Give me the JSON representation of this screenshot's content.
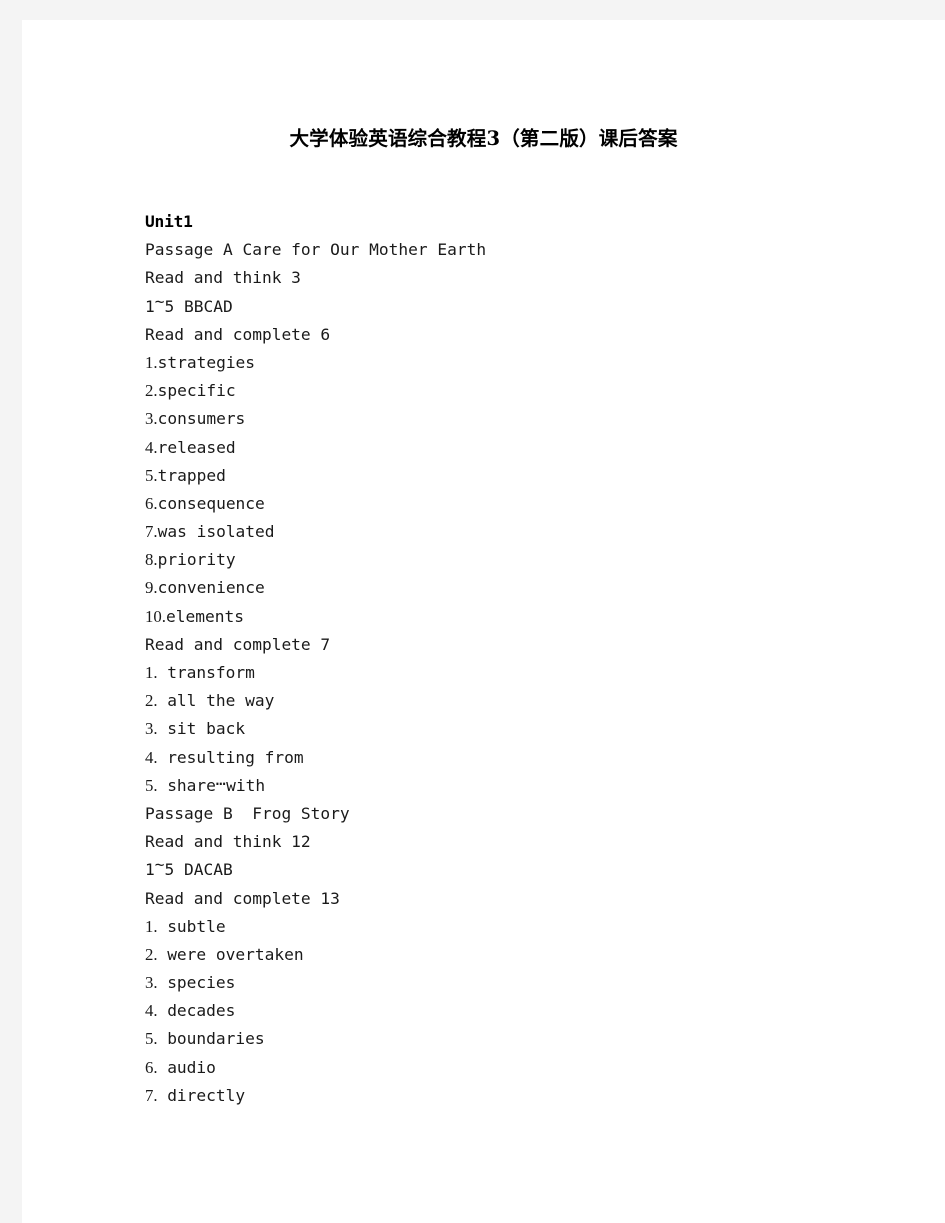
{
  "page": {
    "background_color": "#f4f4f4",
    "sheet_color": "#ffffff",
    "text_color": "#1a1a1a"
  },
  "title": "大学体验英语综合教程3（第二版）课后答案",
  "content": {
    "unit_heading": "Unit1",
    "passage_a_heading": "Passage A Care for Our Mother Earth",
    "read_and_think_3": "Read and think 3",
    "answers_1_5_a_prefix": "1",
    "answers_1_5_a_tilde": "~",
    "answers_1_5_a_suffix": "5 BBCAD",
    "read_and_complete_6": "Read and complete 6",
    "list_6": [
      {
        "marker": "1.",
        "text": "strategies"
      },
      {
        "marker": "2.",
        "text": "specific"
      },
      {
        "marker": "3.",
        "text": "consumers"
      },
      {
        "marker": "4.",
        "text": "released"
      },
      {
        "marker": "5.",
        "text": "trapped"
      },
      {
        "marker": "6.",
        "text": "consequence"
      },
      {
        "marker": "7.",
        "text": "was isolated"
      },
      {
        "marker": "8.",
        "text": "priority"
      },
      {
        "marker": "9.",
        "text": "convenience"
      },
      {
        "marker": "10.",
        "text": "elements"
      }
    ],
    "read_and_complete_7": "Read and complete 7",
    "list_7": [
      {
        "marker": "1.",
        "text": "transform"
      },
      {
        "marker": "2.",
        "text": "all the way"
      },
      {
        "marker": "3.",
        "text": "sit back"
      },
      {
        "marker": "4.",
        "text": "resulting from"
      },
      {
        "marker": "5.",
        "text": "share",
        "ellipsis": "⋯",
        "text_after": "with"
      }
    ],
    "passage_b_heading": "Passage B  Frog Story",
    "read_and_think_12": "Read and think 12",
    "answers_1_5_b_prefix": "1",
    "answers_1_5_b_tilde": "~",
    "answers_1_5_b_suffix": "5 DACAB",
    "read_and_complete_13": "Read and complete 13",
    "list_13": [
      {
        "marker": "1.",
        "text": "subtle"
      },
      {
        "marker": "2.",
        "text": "were overtaken"
      },
      {
        "marker": "3.",
        "text": "species"
      },
      {
        "marker": "4.",
        "text": "decades"
      },
      {
        "marker": "5.",
        "text": "boundaries"
      },
      {
        "marker": "6.",
        "text": "audio"
      },
      {
        "marker": "7.",
        "text": "directly"
      }
    ]
  }
}
